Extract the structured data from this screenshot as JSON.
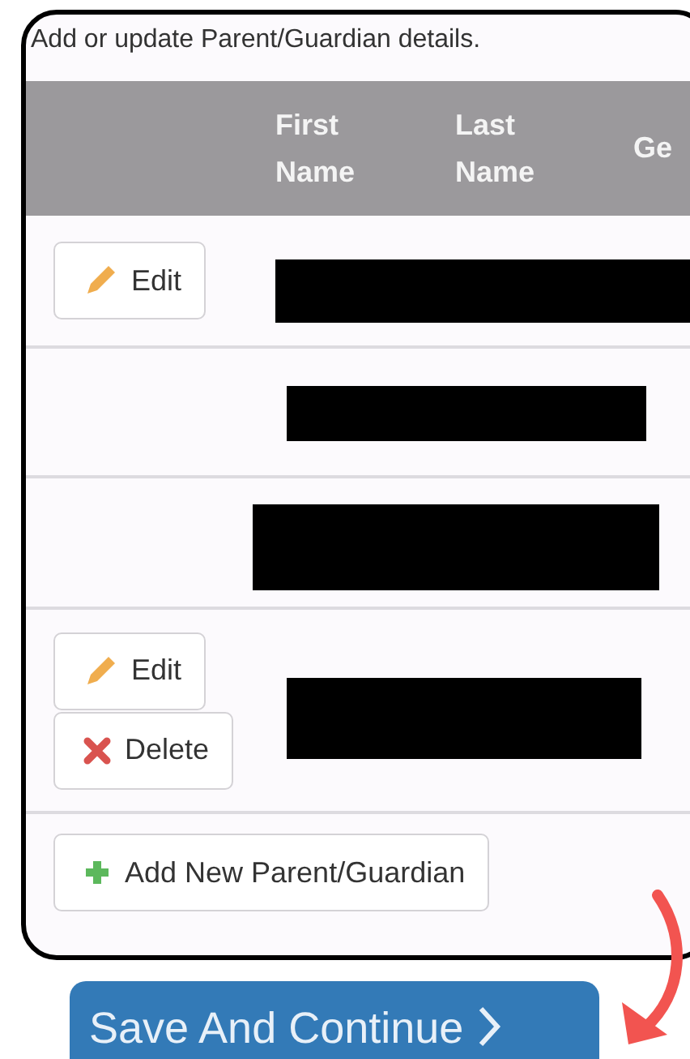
{
  "intro": "Add or update Parent/Guardian details.",
  "table": {
    "columns": [
      "",
      "First Name",
      "Last Name",
      "Ge"
    ],
    "rows": [
      {
        "actions": [
          {
            "kind": "edit",
            "label": "Edit"
          }
        ]
      },
      {
        "actions": []
      },
      {
        "actions": []
      },
      {
        "actions": [
          {
            "kind": "edit",
            "label": "Edit"
          },
          {
            "kind": "delete",
            "label": "Delete"
          }
        ]
      }
    ]
  },
  "add_button": {
    "label": "Add New Parent/Guardian"
  },
  "save_button": {
    "label": "Save And Continue"
  }
}
